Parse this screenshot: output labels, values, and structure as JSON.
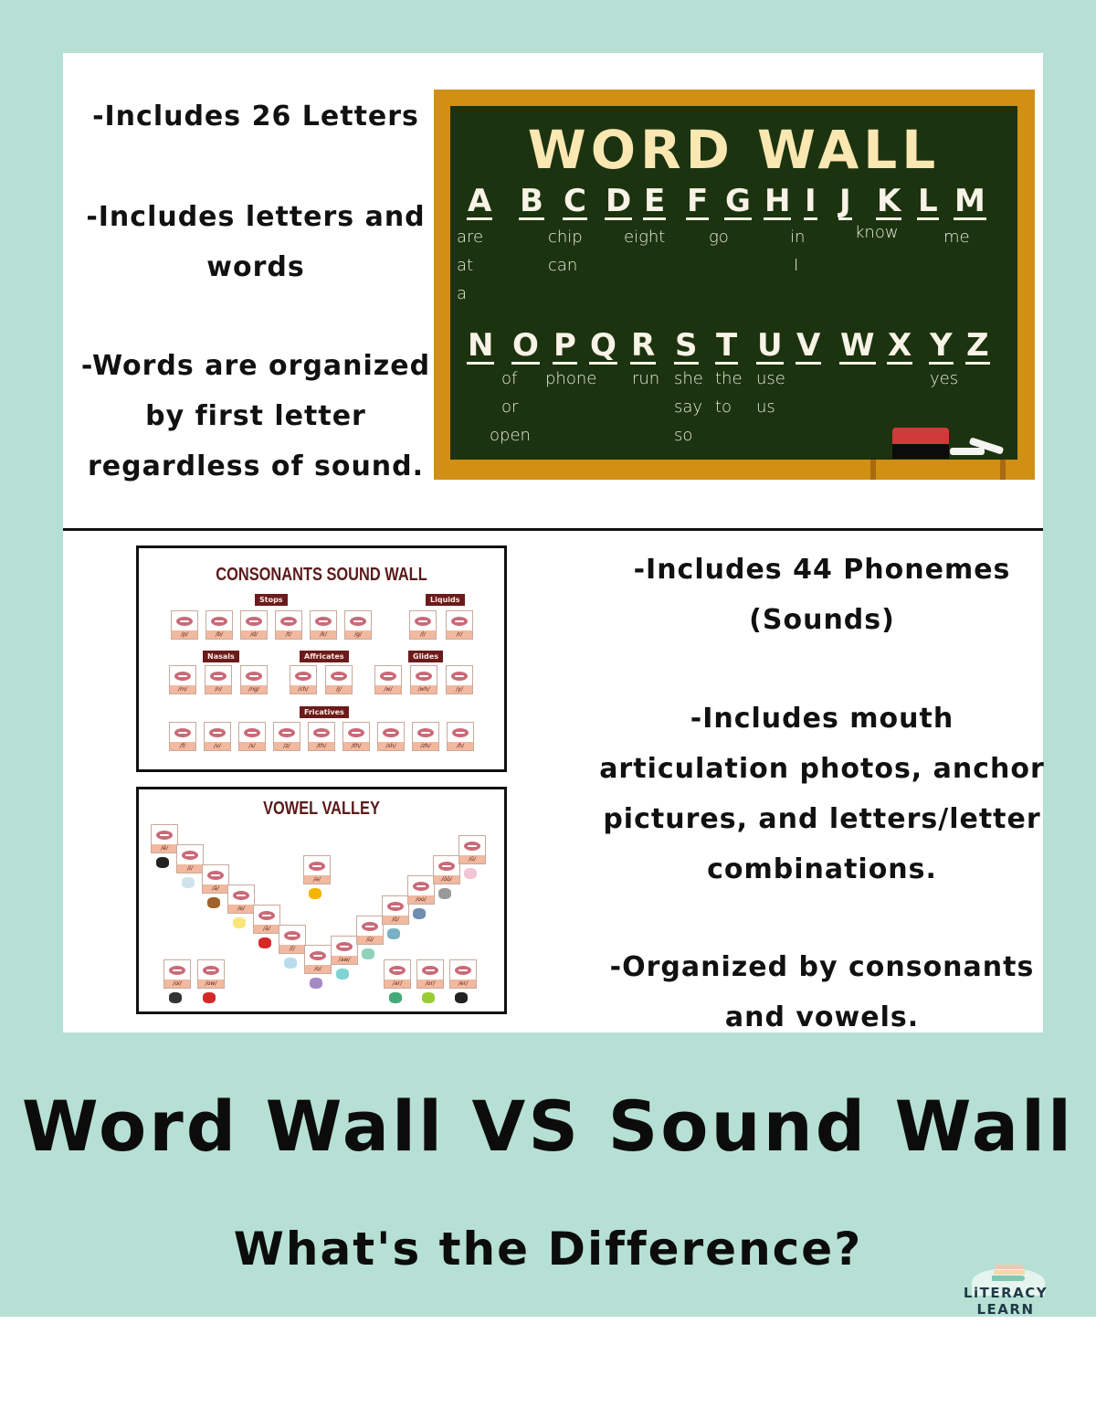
{
  "word_wall": {
    "bullets": [
      "-Includes 26 Letters",
      "-Includes letters and words",
      "-Words are organized by first letter regardless of sound."
    ],
    "board": {
      "title": "WORD WALL",
      "row1": [
        {
          "letter": "A",
          "words": [
            "are",
            "at",
            "a"
          ]
        },
        {
          "letter": "B",
          "words": []
        },
        {
          "letter": "C",
          "words": [
            "chip",
            "can"
          ]
        },
        {
          "letter": "D",
          "words": []
        },
        {
          "letter": "E",
          "words": [
            "eight"
          ]
        },
        {
          "letter": "F",
          "words": []
        },
        {
          "letter": "G",
          "words": [
            "go"
          ]
        },
        {
          "letter": "H",
          "words": []
        },
        {
          "letter": "I",
          "words": [
            "in",
            "I"
          ]
        },
        {
          "letter": "J",
          "words": []
        },
        {
          "letter": "K",
          "words": [
            "know"
          ]
        },
        {
          "letter": "L",
          "words": []
        },
        {
          "letter": "M",
          "words": [
            "me"
          ]
        }
      ],
      "row2": [
        {
          "letter": "N",
          "words": []
        },
        {
          "letter": "O",
          "words": [
            "of",
            "or",
            "open"
          ]
        },
        {
          "letter": "P",
          "words": [
            "phone"
          ]
        },
        {
          "letter": "Q",
          "words": []
        },
        {
          "letter": "R",
          "words": [
            "run"
          ]
        },
        {
          "letter": "S",
          "words": [
            "she",
            "say",
            "so"
          ]
        },
        {
          "letter": "T",
          "words": [
            "the",
            "to"
          ]
        },
        {
          "letter": "U",
          "words": [
            "use",
            "us"
          ]
        },
        {
          "letter": "V",
          "words": []
        },
        {
          "letter": "W",
          "words": []
        },
        {
          "letter": "X",
          "words": []
        },
        {
          "letter": "Y",
          "words": [
            "yes"
          ]
        },
        {
          "letter": "Z",
          "words": []
        }
      ]
    }
  },
  "sound_wall": {
    "bullets": [
      "-Includes 44 Phonemes (Sounds)",
      "-Includes mouth articulation photos, anchor pictures, and letters/letter combinations.",
      "-Organized by consonants and vowels."
    ],
    "consonants": {
      "title": "CONSONANTS SOUND WALL",
      "groups": [
        {
          "name": "Stops",
          "sounds": [
            "/p/",
            "/b/",
            "/d/",
            "/t/",
            "/k/",
            "/g/"
          ]
        },
        {
          "name": "Liquids",
          "sounds": [
            "/l/",
            "/r/"
          ]
        },
        {
          "name": "Nasals",
          "sounds": [
            "/m/",
            "/n/",
            "/ng/"
          ]
        },
        {
          "name": "Affricates",
          "sounds": [
            "/ch/",
            "/j/"
          ]
        },
        {
          "name": "Glides",
          "sounds": [
            "/w/",
            "/wh/",
            "/y/"
          ]
        },
        {
          "name": "Fricatives",
          "sounds": [
            "/f/",
            "/v/",
            "/s/",
            "/z/",
            "/th/",
            "/th/",
            "/sh/",
            "/zh/",
            "/h/"
          ]
        }
      ]
    },
    "vowels": {
      "title": "VOWEL VALLEY",
      "left_slope": [
        "/ē/",
        "/i/",
        "/ā/",
        "/e/",
        "/ă/",
        "/ī/",
        "/o/"
      ],
      "right_slope": [
        "/aw/",
        "/ŭ/",
        "/ō/",
        "/oo/",
        "/ŏŏ/",
        "/ū/"
      ],
      "center": "/ə/",
      "diphthongs": [
        "/oi/",
        "/ow/"
      ],
      "r_controlled": [
        "/ar/",
        "/or/",
        "/er/"
      ]
    }
  },
  "footer": {
    "title": "Word Wall VS Sound Wall",
    "subtitle": "What's the Difference?",
    "logo_text": "LiTERACY LEARN"
  }
}
